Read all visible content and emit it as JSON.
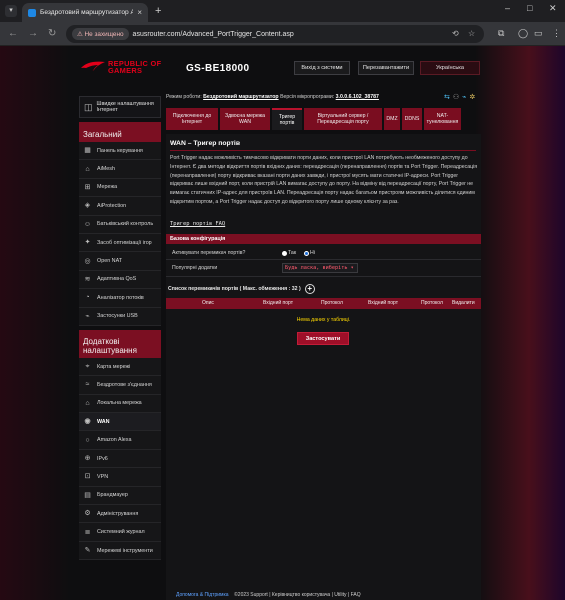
{
  "browser": {
    "tab_title": "Бездротовий маршрутизатор A",
    "new_tab": "+",
    "close": "×",
    "security_label": "Не захищено",
    "url": "asusrouter.com/Advanced_PortTrigger_Content.asp"
  },
  "header": {
    "brand_line1": "REPUBLIC OF",
    "brand_line2": "GAMERS",
    "model": "GS-BE18000",
    "logout": "Вихід з системи",
    "reboot": "Перезавантажити",
    "language": "Українська"
  },
  "infobar": {
    "mode_label": "Режим роботи:",
    "mode_value": "Бездротовий маршрутизатор",
    "fw_label": "Версія мікропрограми:",
    "fw_value": "3.0.0.6.102_38787"
  },
  "sidebar": {
    "quick": "Швидке налаштування Інтернет",
    "general_title": "Загальний",
    "general_items": [
      {
        "label": "Панель керування",
        "icon": "dashboard-icon",
        "glyph": "▦"
      },
      {
        "label": "AiMesh",
        "icon": "aimesh-icon",
        "glyph": "⌂"
      },
      {
        "label": "Мережа",
        "icon": "network-icon",
        "glyph": "⊞"
      },
      {
        "label": "AiProtection",
        "icon": "shield-icon",
        "glyph": "◈"
      },
      {
        "label": "Батьківський контроль",
        "icon": "parental-icon",
        "glyph": "☺"
      },
      {
        "label": "Засоб оптимізації ігор",
        "icon": "game-boost-icon",
        "glyph": "✦"
      },
      {
        "label": "Open NAT",
        "icon": "open-nat-icon",
        "glyph": "◎"
      },
      {
        "label": "Адаптивна QoS",
        "icon": "qos-icon",
        "glyph": "≋"
      },
      {
        "label": "Аналізатор потоків",
        "icon": "traffic-analyzer-icon",
        "glyph": "◔"
      },
      {
        "label": "Застосунки USB",
        "icon": "usb-icon",
        "glyph": "⌁"
      }
    ],
    "advanced_title": "Додаткові налаштування",
    "advanced_items": [
      {
        "label": "Карта мережі",
        "icon": "network-map-icon",
        "glyph": "⌖"
      },
      {
        "label": "Бездротове з'єднання",
        "icon": "wireless-icon",
        "glyph": "≈"
      },
      {
        "label": "Локальна мережа",
        "icon": "lan-icon",
        "glyph": "⌂"
      },
      {
        "label": "WAN",
        "icon": "wan-icon",
        "glyph": "◉",
        "active": true
      },
      {
        "label": "Amazon Alexa",
        "icon": "alexa-icon",
        "glyph": "○"
      },
      {
        "label": "IPv6",
        "icon": "ipv6-icon",
        "glyph": "⊕"
      },
      {
        "label": "VPN",
        "icon": "vpn-icon",
        "glyph": "⊡"
      },
      {
        "label": "Брандмауер",
        "icon": "firewall-icon",
        "glyph": "▤"
      },
      {
        "label": "Адміністрування",
        "icon": "admin-icon",
        "glyph": "⚙"
      },
      {
        "label": "Системний журнал",
        "icon": "syslog-icon",
        "glyph": "≣"
      },
      {
        "label": "Мережеві інструменти",
        "icon": "network-tools-icon",
        "glyph": "✎"
      }
    ]
  },
  "tabs": [
    {
      "label": "Підключення до Інтернет",
      "w": 52
    },
    {
      "label": "Здвоєна мережа WAN",
      "w": 50
    },
    {
      "label": "Тригер портів",
      "w": 30,
      "active": true
    },
    {
      "label": "Віртуальний сервер / Переадресація порту",
      "w": 78
    },
    {
      "label": "DMZ",
      "w": 16
    },
    {
      "label": "DDNS",
      "w": 20
    },
    {
      "label": "NAT-тунелювання",
      "w": 37
    }
  ],
  "main": {
    "title": "WAN – Тригер портів",
    "description": "Port Trigger надає можливість тимчасово відкривати порти даних, коли пристрої LAN потребують необмеженого доступу до Інтернет. Є два методи відкриття портів вхідних даних: переадресація (перенаправлення) портів та Port Trigger. Переадресація (перенаправлення) порту відкриває вказані порти даних завжди, і пристрої мусять мати статичні IP-адреси. Port Trigger відкриває лише вхідний порт, коли пристрій LAN вимагає доступу до порту. На відміну від переадресації порту, Port Trigger не вимагає статичних IP-адрес для пристроїв LAN. Переадресація порту надає багатьом пристроям можливість ділитися єдиним відкритим портом, а Port Trigger надає доступ до відкритого порту лише одному клієнту за раз.",
    "faq": "Тригер портів FAQ",
    "config_title": "Базова конфігурація",
    "enable_label": "Активувати перемикач портів?",
    "yes": "Так",
    "no": "Ні",
    "popular_label": "Популярні додатки",
    "popular_value": "Будь ласка, виберіть",
    "list_title": "Список перемикачів портів ( Макс. обмеження : 32 )",
    "columns": [
      "Опис",
      "Вхідний порт",
      "Протокол",
      "Вхідний порт",
      "Протокол",
      "Видалити"
    ],
    "no_data": "Нема даних у таблиці.",
    "apply": "Застосувати"
  },
  "footer": {
    "help": "Допомога & Підтримка",
    "links": "©2023 Support | Керівництво користувача | Utility | FAQ"
  },
  "colors": {
    "accent": "#7b0f22",
    "active_tab_border": "#b8122d",
    "nodata": "#ffd900"
  }
}
